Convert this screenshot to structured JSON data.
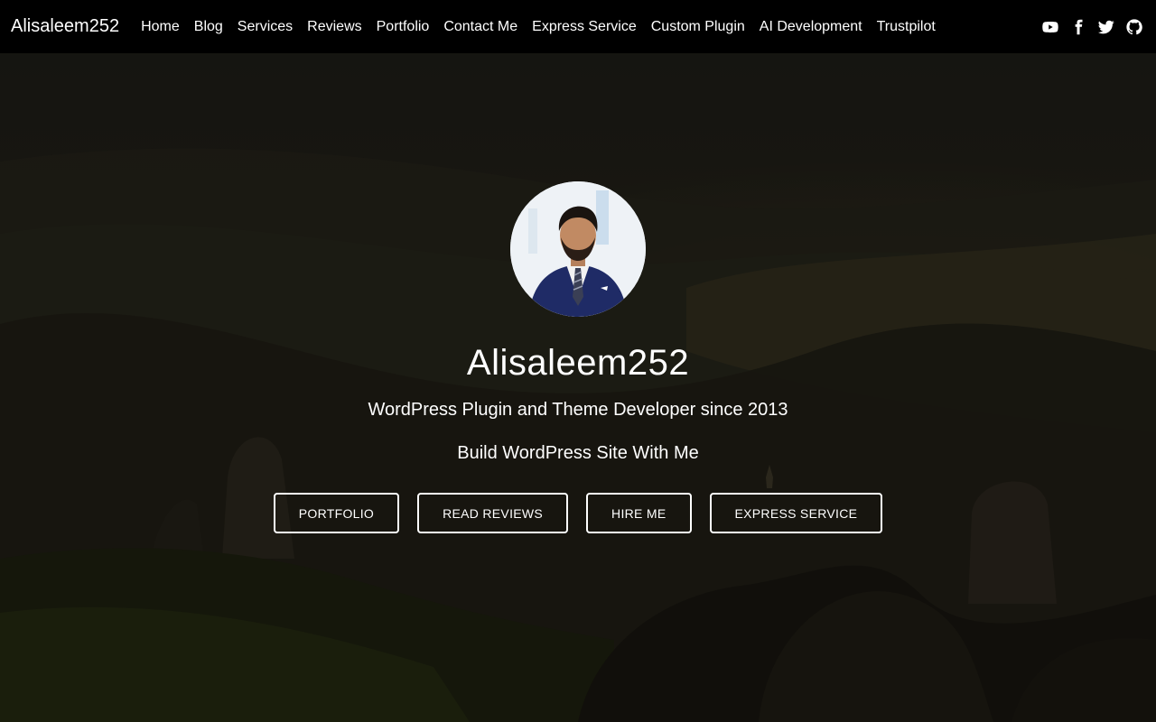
{
  "navbar": {
    "brand": "Alisaleem252",
    "links": [
      {
        "label": "Home"
      },
      {
        "label": "Blog"
      },
      {
        "label": "Services"
      },
      {
        "label": "Reviews"
      },
      {
        "label": "Portfolio"
      },
      {
        "label": "Contact Me"
      },
      {
        "label": "Express Service"
      },
      {
        "label": "Custom Plugin"
      },
      {
        "label": "AI Development"
      },
      {
        "label": "Trustpilot"
      }
    ],
    "social_icons": [
      "youtube-icon",
      "facebook-icon",
      "twitter-icon",
      "github-icon"
    ]
  },
  "hero": {
    "title": "Alisaleem252",
    "subtitle": "WordPress Plugin and Theme Developer since 2013",
    "tagline": "Build WordPress Site With Me",
    "buttons": [
      {
        "label": "PORTFOLIO"
      },
      {
        "label": "READ REVIEWS"
      },
      {
        "label": "HIRE ME"
      },
      {
        "label": "EXPRESS SERVICE"
      }
    ]
  },
  "colors": {
    "navbar_bg": "#000000",
    "text": "#ffffff",
    "button_border": "#ffffff"
  }
}
